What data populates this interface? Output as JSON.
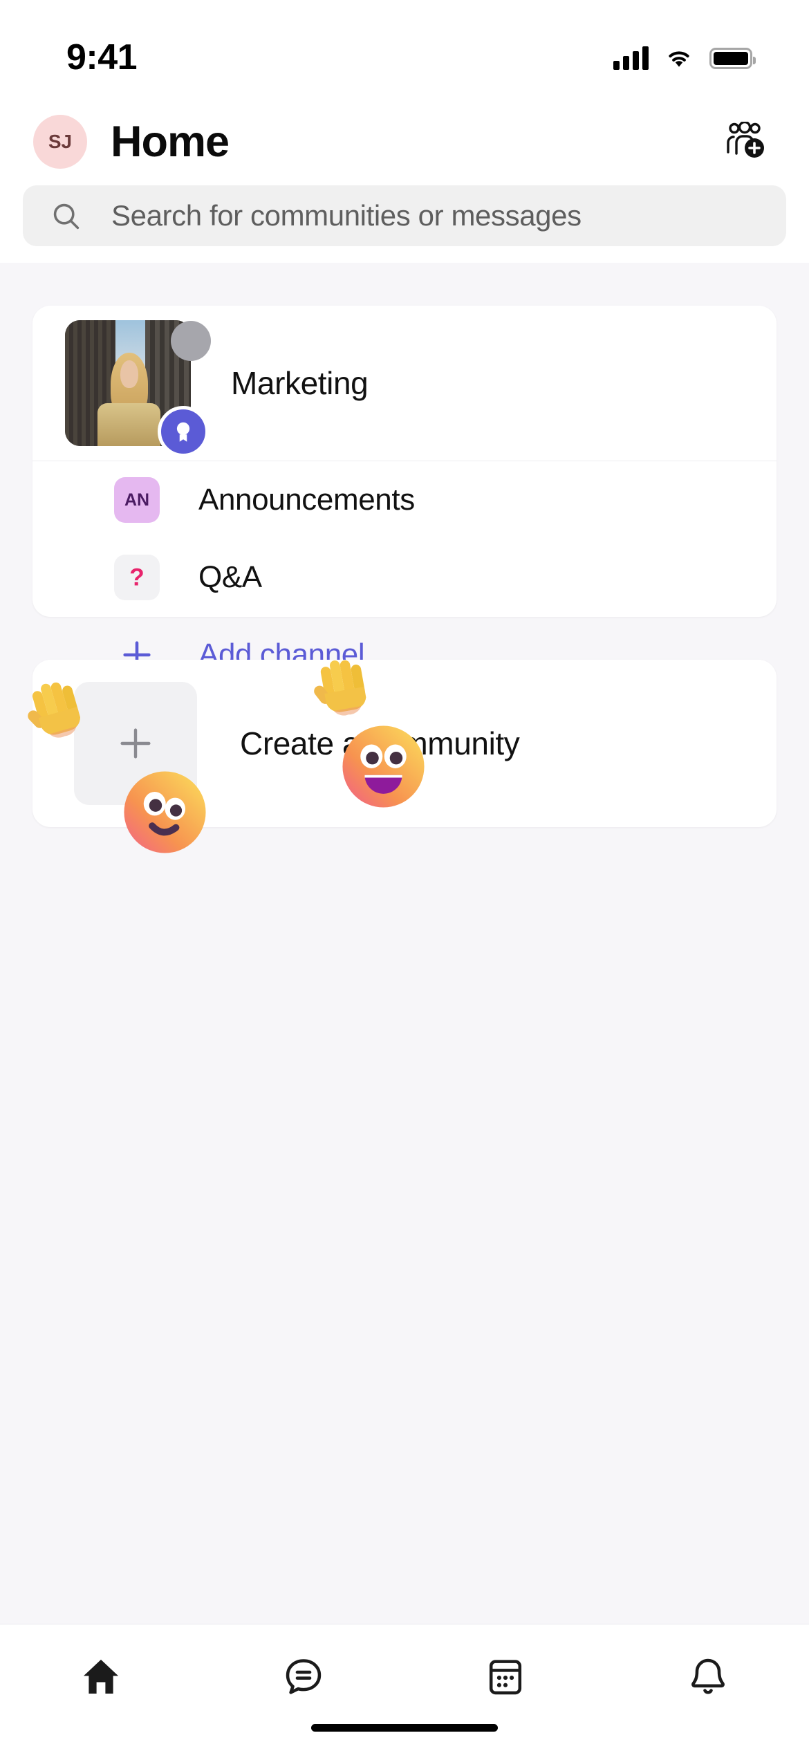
{
  "status_bar": {
    "time": "9:41",
    "icons": [
      "cellular-signal-icon",
      "wifi-icon",
      "battery-icon"
    ]
  },
  "header": {
    "avatar_initials": "SJ",
    "title": "Home",
    "action_icon": "add-people-icon"
  },
  "search": {
    "placeholder": "Search for communities or messages",
    "icon": "search-icon",
    "value": ""
  },
  "community_card": {
    "community": {
      "name": "Marketing",
      "badge_icon": "award-badge-icon",
      "thumbnail": "community-photo"
    },
    "channels": [
      {
        "initials": "AN",
        "label": "Announcements",
        "chip_color": "#E5B8F0",
        "chip_text_color": "#4B1C63"
      },
      {
        "initials": "?",
        "label": "Q&A",
        "chip_color": "#F2F2F4",
        "chip_text_color": "#E8246C"
      }
    ],
    "add_channel": {
      "label": "Add channel",
      "icon": "plus-icon",
      "color": "#5B5BD6"
    }
  },
  "create_card": {
    "label": "Create a community",
    "icon": "plus-icon"
  },
  "stickers": [
    {
      "name": "waving-hand-emoji",
      "glyph": "wave"
    },
    {
      "name": "waving-hand-emoji",
      "glyph": "wave"
    },
    {
      "name": "smiling-face-emoji",
      "glyph": "smile"
    },
    {
      "name": "grinning-face-emoji",
      "glyph": "grin"
    }
  ],
  "bottom_nav": [
    {
      "name": "home",
      "icon": "home-icon",
      "active": true
    },
    {
      "name": "chat",
      "icon": "chat-icon",
      "active": false
    },
    {
      "name": "calendar",
      "icon": "calendar-icon",
      "active": false
    },
    {
      "name": "notifications",
      "icon": "bell-icon",
      "active": false
    }
  ],
  "colors": {
    "accent": "#5B5BD6",
    "background": "#F7F6F9",
    "card": "#FFFFFF",
    "search_bg": "#F0F0F0"
  }
}
